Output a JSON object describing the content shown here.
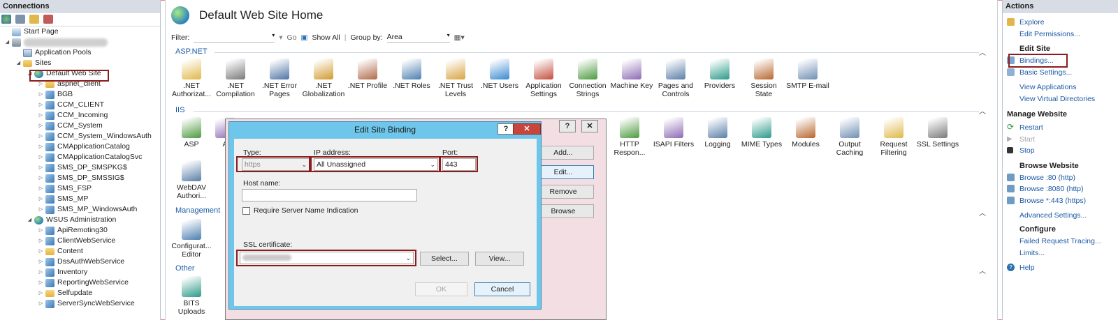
{
  "connections": {
    "title": "Connections",
    "tree": [
      {
        "label": "Start Page",
        "icon": "start-page-icon"
      },
      {
        "label": "",
        "icon": "server-icon",
        "redacted": true
      },
      {
        "label": "Application Pools",
        "icon": "application-pools-icon"
      },
      {
        "label": "Sites",
        "icon": "sites-folder-icon"
      },
      {
        "label": "Default Web Site",
        "icon": "website-globe-icon",
        "selected": true
      },
      {
        "label": "aspnet_client",
        "icon": "folder-icon"
      },
      {
        "label": "BGB",
        "icon": "application-icon"
      },
      {
        "label": "CCM_CLIENT",
        "icon": "application-icon"
      },
      {
        "label": "CCM_Incoming",
        "icon": "application-icon"
      },
      {
        "label": "CCM_System",
        "icon": "application-icon"
      },
      {
        "label": "CCM_System_WindowsAuth",
        "icon": "application-icon"
      },
      {
        "label": "CMApplicationCatalog",
        "icon": "application-icon"
      },
      {
        "label": "CMApplicationCatalogSvc",
        "icon": "application-icon"
      },
      {
        "label": "SMS_DP_SMSPKG$",
        "icon": "application-icon"
      },
      {
        "label": "SMS_DP_SMSSIG$",
        "icon": "application-icon"
      },
      {
        "label": "SMS_FSP",
        "icon": "application-icon"
      },
      {
        "label": "SMS_MP",
        "icon": "application-icon"
      },
      {
        "label": "SMS_MP_WindowsAuth",
        "icon": "application-icon"
      },
      {
        "label": "WSUS Administration",
        "icon": "website-globe-icon"
      },
      {
        "label": "ApiRemoting30",
        "icon": "application-icon"
      },
      {
        "label": "ClientWebService",
        "icon": "application-icon"
      },
      {
        "label": "Content",
        "icon": "folder-icon"
      },
      {
        "label": "DssAuthWebService",
        "icon": "application-icon"
      },
      {
        "label": "Inventory",
        "icon": "application-icon"
      },
      {
        "label": "ReportingWebService",
        "icon": "application-icon"
      },
      {
        "label": "Selfupdate",
        "icon": "folder-icon"
      },
      {
        "label": "ServerSyncWebService",
        "icon": "application-icon"
      }
    ]
  },
  "main": {
    "title": "Default Web Site Home",
    "filter_label": "Filter:",
    "go_label": "Go",
    "show_all_label": "Show All",
    "group_by_label": "Group by:",
    "group_by_value": "Area",
    "sections": {
      "aspnet": "ASP.NET",
      "iis": "IIS",
      "management": "Management",
      "other": "Other"
    },
    "aspnet_features": [
      {
        "label": ".NET Authorizat...",
        "icon": "net-authorization-icon"
      },
      {
        "label": ".NET Compilation",
        "icon": "net-compilation-icon"
      },
      {
        "label": ".NET Error Pages",
        "icon": "net-error-pages-icon"
      },
      {
        "label": ".NET Globalization",
        "icon": "net-globalization-icon"
      },
      {
        "label": ".NET Profile",
        "icon": "net-profile-icon"
      },
      {
        "label": ".NET Roles",
        "icon": "net-roles-icon"
      },
      {
        "label": ".NET Trust Levels",
        "icon": "net-trust-levels-icon"
      },
      {
        "label": ".NET Users",
        "icon": "net-users-icon"
      },
      {
        "label": "Application Settings",
        "icon": "application-settings-icon"
      },
      {
        "label": "Connection Strings",
        "icon": "connection-strings-icon"
      },
      {
        "label": "Machine Key",
        "icon": "machine-key-icon"
      },
      {
        "label": "Pages and Controls",
        "icon": "pages-controls-icon"
      },
      {
        "label": "Providers",
        "icon": "providers-icon"
      },
      {
        "label": "Session State",
        "icon": "session-state-icon"
      },
      {
        "label": "SMTP E-mail",
        "icon": "smtp-email-icon"
      }
    ],
    "iis_features_left": [
      {
        "label": "ASP",
        "icon": "asp-icon"
      },
      {
        "label": "A",
        "icon": "authentication-icon"
      }
    ],
    "iis_features_right": [
      {
        "label": "HTTP Respon...",
        "icon": "http-response-icon"
      },
      {
        "label": "ISAPI Filters",
        "icon": "isapi-filters-icon"
      },
      {
        "label": "Logging",
        "icon": "logging-icon"
      },
      {
        "label": "MIME Types",
        "icon": "mime-types-icon"
      },
      {
        "label": "Modules",
        "icon": "modules-icon"
      },
      {
        "label": "Output Caching",
        "icon": "output-caching-icon"
      },
      {
        "label": "Request Filtering",
        "icon": "request-filtering-icon"
      },
      {
        "label": "SSL Settings",
        "icon": "ssl-settings-icon"
      }
    ],
    "iis_features_row2": [
      {
        "label": "WebDAV Authori...",
        "icon": "webdav-icon"
      }
    ],
    "management_features": [
      {
        "label": "Configurat... Editor",
        "icon": "configuration-editor-icon"
      }
    ],
    "other_features": [
      {
        "label": "BITS Uploads",
        "icon": "bits-uploads-icon"
      }
    ]
  },
  "bindings_dialog": {
    "help": "?",
    "close": "✕",
    "add": "Add...",
    "edit": "Edit...",
    "remove": "Remove",
    "browse": "Browse"
  },
  "edit_dialog": {
    "title": "Edit Site Binding",
    "help": "?",
    "close": "✕",
    "type_label": "Type:",
    "type_value": "https",
    "ip_label": "IP address:",
    "ip_value": "All Unassigned",
    "port_label": "Port:",
    "port_value": "443",
    "host_label": "Host name:",
    "host_value": "",
    "sni_label": "Require Server Name Indication",
    "ssl_label": "SSL certificate:",
    "ssl_value": "",
    "select": "Select...",
    "view": "View...",
    "ok": "OK",
    "cancel": "Cancel"
  },
  "actions": {
    "title": "Actions",
    "explore": "Explore",
    "edit_permissions": "Edit Permissions...",
    "edit_site": "Edit Site",
    "bindings": "Bindings...",
    "basic_settings": "Basic Settings...",
    "view_applications": "View Applications",
    "view_virtual_directories": "View Virtual Directories",
    "manage_website": "Manage Website",
    "restart": "Restart",
    "start": "Start",
    "stop": "Stop",
    "browse_website": "Browse Website",
    "browse_80": "Browse :80 (http)",
    "browse_8080": "Browse :8080 (http)",
    "browse_443": "Browse *:443 (https)",
    "advanced_settings": "Advanced Settings...",
    "configure": "Configure",
    "failed_request_tracing": "Failed Request Tracing...",
    "limits": "Limits...",
    "help": "Help"
  },
  "colors": {
    "highlight": "#8c1b1b",
    "link": "#1c5aa6",
    "dialog_title": "#6ec6ea",
    "close_button": "#c7453a"
  }
}
